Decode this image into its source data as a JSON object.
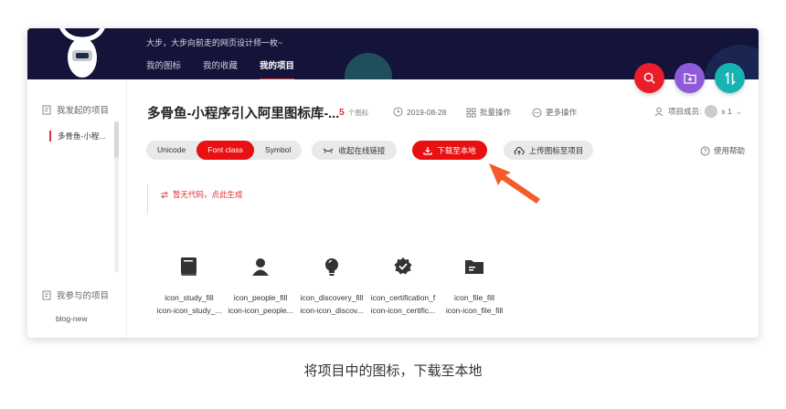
{
  "header": {
    "slogan": "大步，大步向前走的网页设计师一枚~",
    "nav": [
      "我的图标",
      "我的收藏",
      "我的项目"
    ],
    "active_nav": "我的项目"
  },
  "fabs": [
    {
      "icon": "search-icon",
      "color": "#e81e2b"
    },
    {
      "icon": "add-folder-icon",
      "color": "#8e5bd8"
    },
    {
      "icon": "transfer-icon",
      "color": "#17b3b3"
    }
  ],
  "sidebar": {
    "my_projects_label": "我发起的项目",
    "project_item": "多骨鱼-小程...",
    "joined_label": "我参与的项目",
    "joined_item": "blog-new"
  },
  "project": {
    "title": "多骨鱼-小程序引入阿里图标库-...",
    "icon_count": "5",
    "icon_count_unit": "个图标",
    "date": "2019-08-28",
    "batch_label": "批量操作",
    "more_label": "更多操作",
    "members_label": "项目成员:",
    "members_count": "x 1"
  },
  "toolbar": {
    "tabs": [
      "Unicode",
      "Font class",
      "Symbol"
    ],
    "active_tab": "Font class",
    "collapse_link": "收起在线链接",
    "download": "下载至本地",
    "upload": "上传图标至项目",
    "help": "使用帮助"
  },
  "code": {
    "empty_text": "暂无代码，点此生成"
  },
  "icons": [
    {
      "name": "icon_study_fill",
      "class": "icon-icon_study_..."
    },
    {
      "name": "icon_people_fill",
      "class": "icon-icon_people..."
    },
    {
      "name": "icon_discovery_fill",
      "class": "icon-icon_discov..."
    },
    {
      "name": "icon_certification_f",
      "class": "icon-icon_certific..."
    },
    {
      "name": "icon_file_fill",
      "class": "icon-icon_file_fill"
    }
  ],
  "caption": "将项目中的图标，下载至本地",
  "colors": {
    "accent": "#e81010",
    "header_bg": "#14143a",
    "arrow": "#f45a2a"
  }
}
